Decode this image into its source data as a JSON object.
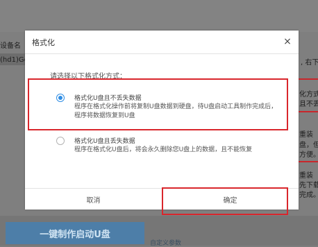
{
  "background": {
    "device_label": "设备名",
    "device_value": "(hd1)Ge",
    "right_texts": [
      ", 右下",
      "化方式",
      "且不丢",
      "重装",
      "盘，但",
      "方便。",
      "重装",
      "先下载",
      "完成。"
    ],
    "primary_button": "一键制作启动U盘",
    "link_text": "自定义参数"
  },
  "dialog": {
    "title": "格式化",
    "close_icon": "×",
    "instruction": "请选择以下格式化方式：",
    "options": [
      {
        "title": "格式化U盘且不丢失数据",
        "desc": "程序在格式化操作前将复制U盘数据到硬盘，待U盘启动工具制作完成后，程序将数据恢复到U盘",
        "checked": true
      },
      {
        "title": "格式化U盘且丢失数据",
        "desc": "程序在格式化U盘后，将会永久删除您U盘上的数据，且不能恢复",
        "checked": false
      }
    ],
    "cancel_label": "取消",
    "confirm_label": "确定"
  },
  "colors": {
    "highlight": "#d9262c",
    "radio_accent": "#2f8de4",
    "primary_button": "#4d7ea8"
  }
}
